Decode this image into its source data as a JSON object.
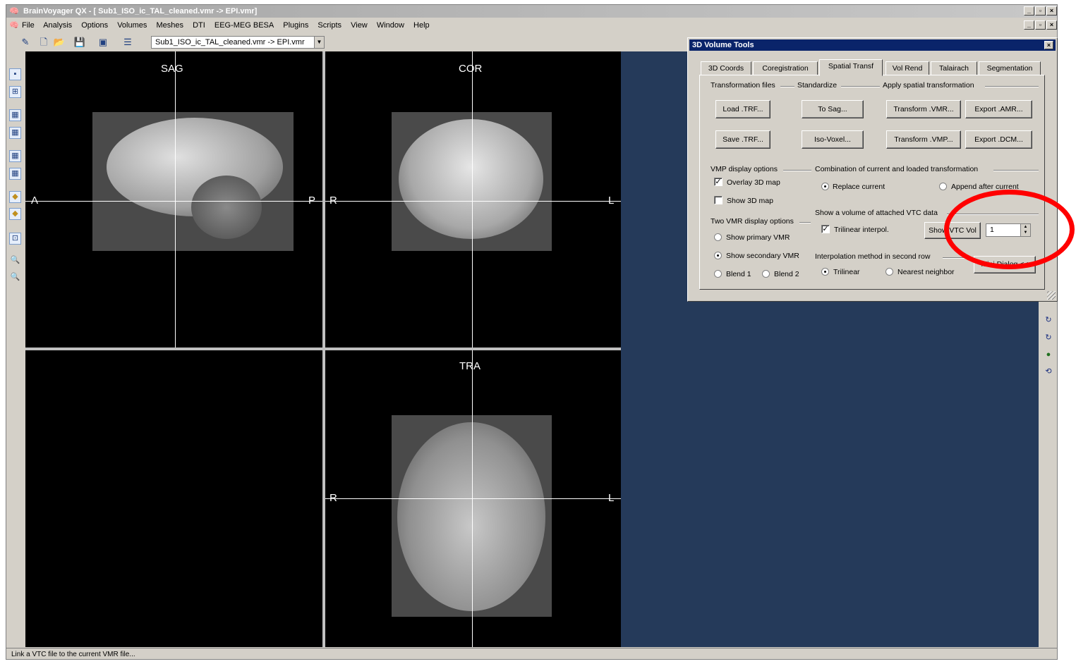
{
  "window": {
    "title": "BrainVoyager QX - [ Sub1_ISO_ic_TAL_cleaned.vmr  ->  EPI.vmr]"
  },
  "menu": [
    "File",
    "Analysis",
    "Options",
    "Volumes",
    "Meshes",
    "DTI",
    "EEG-MEG BESA",
    "Plugins",
    "Scripts",
    "View",
    "Window",
    "Help"
  ],
  "toolbar": {
    "document_select": "Sub1_ISO_ic_TAL_cleaned.vmr  ->  EPI.vmr"
  },
  "views": {
    "sag": {
      "label": "SAG",
      "left": "A",
      "right": "P"
    },
    "cor": {
      "label": "COR",
      "left": "R",
      "right": "L"
    },
    "tra": {
      "label": "TRA",
      "left": "R",
      "right": "L"
    }
  },
  "status": {
    "text": "Link a VTC file to the current VMR file..."
  },
  "dialog": {
    "title": "3D Volume Tools",
    "tabs": [
      "3D Coords",
      "Coregistration",
      "Spatial Transf",
      "Vol Rend",
      "Talairach",
      "Segmentation"
    ],
    "active_tab": "Spatial Transf",
    "groups": {
      "transformation_files": "Transformation files",
      "standardize": "Standardize",
      "apply_spatial": "Apply spatial transformation",
      "vmp_display": "VMP display options",
      "combination": "Combination of current and loaded transformation",
      "two_vmr": "Two VMR display options",
      "show_vtc": "Show a volume of attached VTC data",
      "interp": "Interpolation method in second row"
    },
    "buttons": {
      "load_trf": "Load .TRF...",
      "save_trf": "Save .TRF...",
      "to_sag": "To Sag...",
      "iso_voxel": "Iso-Voxel...",
      "transform_vmr": "Transform .VMR...",
      "transform_vmp": "Transform .VMP...",
      "export_amr": "Export .AMR...",
      "export_dcm": "Export .DCM...",
      "show_vtc_vol": "Show VTC Vol",
      "mini_dialog": "Mini Dialog <<"
    },
    "options": {
      "overlay_3d": "Overlay 3D map",
      "show_3d": "Show 3D map",
      "replace_current": "Replace current",
      "append_after": "Append after current",
      "trilinear_interpol": "Trilinear interpol.",
      "show_primary": "Show primary VMR",
      "show_secondary": "Show secondary VMR",
      "blend1": "Blend 1",
      "blend2": "Blend 2",
      "trilinear": "Trilinear",
      "nearest": "Nearest neighbor"
    },
    "vtc_volume_value": "1"
  }
}
